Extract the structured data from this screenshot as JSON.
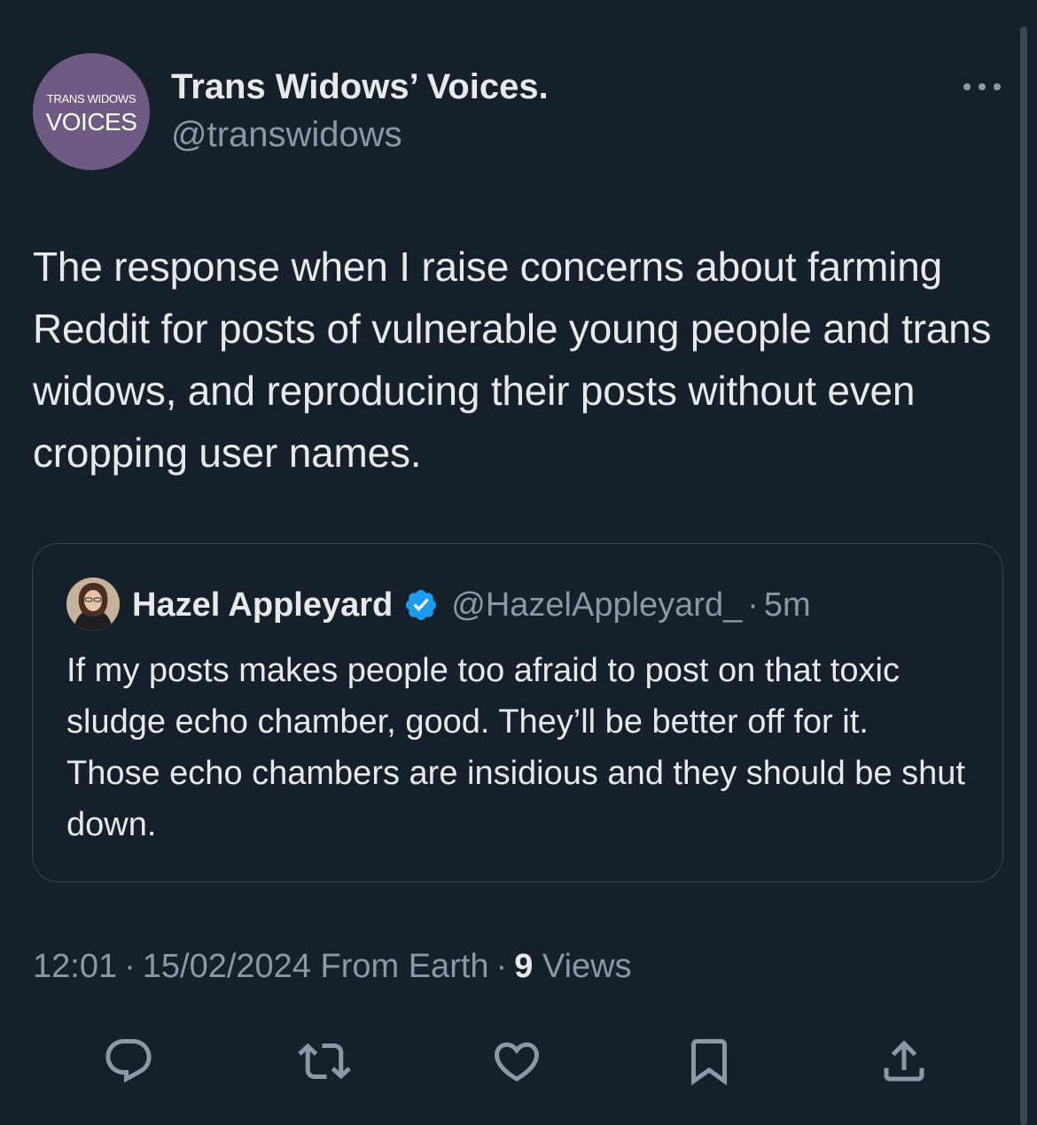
{
  "tweet": {
    "author": {
      "display_name": "Trans Widows’ Voices.",
      "handle": "@transwidows",
      "avatar_text_top": "TRANS WIDOWS",
      "avatar_text_bottom": "VOICES"
    },
    "text": "The response when I raise concerns about farming Reddit for posts of vulnerable young people and trans widows, and reproducing their posts without even cropping user names.",
    "quoted": {
      "display_name": "Hazel Appleyard",
      "verified": true,
      "handle": "@HazelAppleyard_",
      "separator": "·",
      "time": "5m",
      "text": "If my posts makes people too afraid to post on that toxic sludge echo chamber, good. They’ll be better off for it. Those echo chambers are insidious and they should be shut down."
    },
    "meta": {
      "time": "12:01",
      "separator": "·",
      "date": "15/02/2024",
      "source": "From Earth",
      "views_count": "9",
      "views_label": "Views"
    },
    "actions": [
      {
        "name": "reply",
        "icon": "speech-bubble-icon"
      },
      {
        "name": "retweet",
        "icon": "retweet-arrows-icon"
      },
      {
        "name": "like",
        "icon": "heart-icon"
      },
      {
        "name": "bookmark",
        "icon": "bookmark-icon"
      },
      {
        "name": "share",
        "icon": "share-upload-icon"
      }
    ]
  },
  "colors": {
    "background": "#15202b",
    "primary_text": "#e7e9ea",
    "secondary_text": "#8b98a5",
    "border": "#38444d",
    "verified_blue": "#1d9bf0",
    "avatar_purple": "#6e5a82"
  }
}
